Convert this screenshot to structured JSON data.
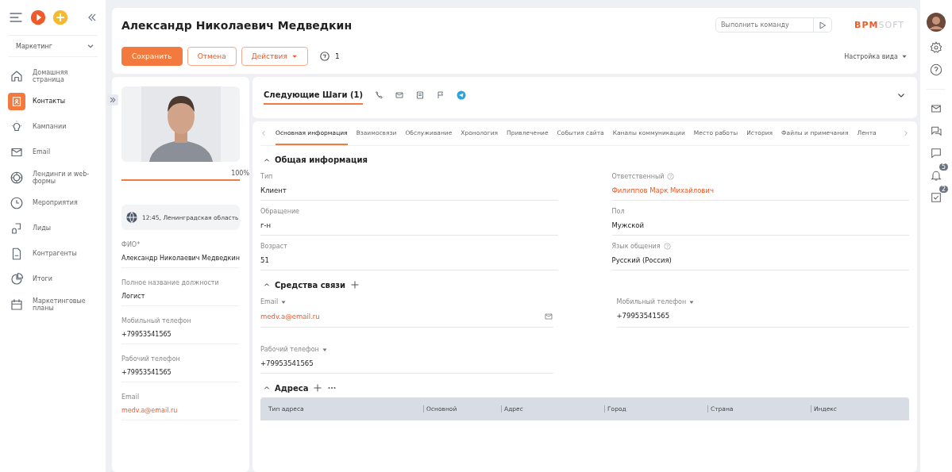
{
  "sidebar": {
    "workspace": "Маркетинг",
    "items": [
      {
        "label": "Домашняя страница",
        "selected": false
      },
      {
        "label": "Контакты",
        "selected": true
      },
      {
        "label": "Кампании",
        "selected": false
      },
      {
        "label": "Email",
        "selected": false
      },
      {
        "label": "Лендинги и web-формы",
        "selected": false
      },
      {
        "label": "Мероприятия",
        "selected": false
      },
      {
        "label": "Лиды",
        "selected": false
      },
      {
        "label": "Контрагенты",
        "selected": false
      },
      {
        "label": "Итоги",
        "selected": false
      },
      {
        "label": "Маркетинговые планы",
        "selected": false
      }
    ]
  },
  "header": {
    "title": "Александр Николаевич Медведкин",
    "command": {
      "placeholder": "Выполнить команду"
    },
    "logo": {
      "primary": "ВРМ",
      "secondary": "SOFT"
    },
    "buttons": [
      {
        "label": "Сохранить",
        "kind": "primary"
      },
      {
        "label": "Отмена",
        "kind": "outline"
      },
      {
        "label": "Действия",
        "kind": "dropdown"
      }
    ],
    "tags_count": "1",
    "view_settings": "Настройка вида"
  },
  "profile": {
    "completeness": {
      "level": 1,
      "reading": "100%"
    },
    "location": "12:45, Ленинградская область",
    "fields": [
      {
        "label": "ФИО*",
        "value": "Александр Николаевич Медведкин",
        "kind": "text"
      },
      {
        "label": "Полное название должности",
        "value": "Логист",
        "kind": "text"
      },
      {
        "label": "Мобильный телефон",
        "value": "+79953541565",
        "kind": "text"
      },
      {
        "label": "Рабочий телефон",
        "value": "+79953541565",
        "kind": "text"
      },
      {
        "label": "Email",
        "value": "medv.a@email.ru",
        "kind": "link"
      }
    ]
  },
  "next_steps": {
    "label": "Следующие Шаги (1)",
    "selected": true
  },
  "tabs": [
    {
      "label": "Основная информация",
      "selected": true
    },
    {
      "label": "Взаимосвязи",
      "selected": false
    },
    {
      "label": "Обслуживание",
      "selected": false
    },
    {
      "label": "Хронология",
      "selected": false
    },
    {
      "label": "Привлечение",
      "selected": false
    },
    {
      "label": "События сайта",
      "selected": false
    },
    {
      "label": "Каналы коммуникации",
      "selected": false
    },
    {
      "label": "Место работы",
      "selected": false
    },
    {
      "label": "История",
      "selected": false
    },
    {
      "label": "Файлы и примечания",
      "selected": false
    },
    {
      "label": "Лента",
      "selected": false
    }
  ],
  "general": {
    "title": "Общая информация",
    "fields": [
      {
        "label": "Тип",
        "value": "Клиент",
        "kind": "text",
        "help": false
      },
      {
        "label": "Ответственный",
        "value": "Филиппов Марк Михайлович",
        "kind": "link",
        "help": true
      },
      {
        "label": "Обращение",
        "value": "г-н",
        "kind": "text",
        "help": false
      },
      {
        "label": "Пол",
        "value": "Мужской",
        "kind": "text",
        "help": false
      },
      {
        "label": "Возраст",
        "value": "51",
        "kind": "text",
        "help": false
      },
      {
        "label": "Язык общения",
        "value": "Русский (Россия)",
        "kind": "text",
        "help": true
      }
    ]
  },
  "contacts": {
    "title": "Средства связи",
    "fields": [
      {
        "label": "Email",
        "value": "medv.a@email.ru",
        "kind": "link"
      },
      {
        "label": "Мобильный телефон",
        "value": "+79953541565",
        "kind": "text"
      },
      {
        "label": "Рабочий телефон",
        "value": "+79953541565",
        "kind": "text"
      }
    ]
  },
  "addresses": {
    "title": "Адреса",
    "columns": [
      "Тип адреса",
      "Основной",
      "Адрес",
      "Город",
      "Страна",
      "Индекс"
    ]
  },
  "rightbar": {
    "badges": [
      "5",
      "2"
    ]
  }
}
